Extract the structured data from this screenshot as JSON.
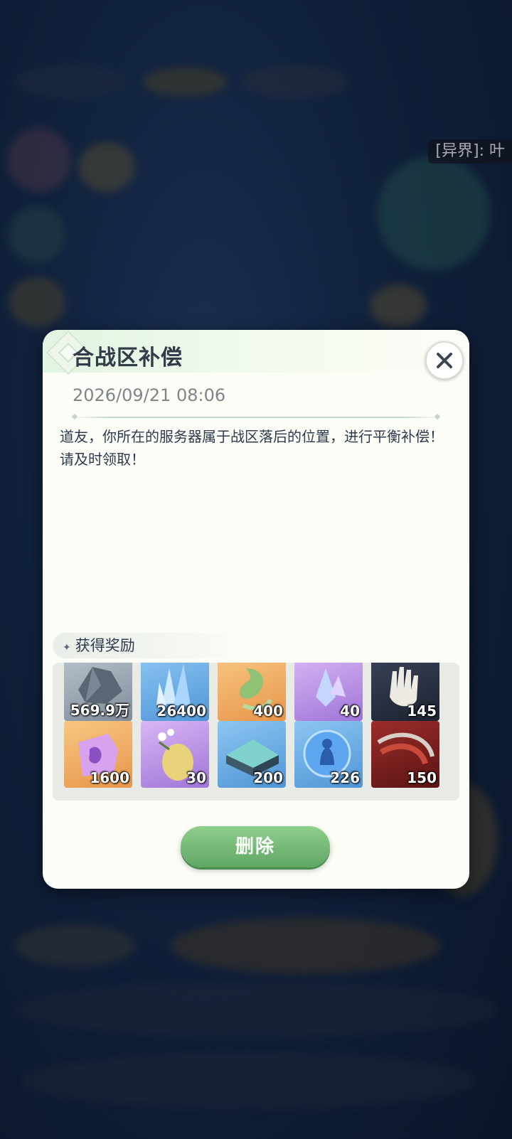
{
  "background": {
    "tag_text": "[异界]: 叶"
  },
  "dialog": {
    "title": "合战区补偿",
    "date": "2026/09/21 08:06",
    "message": "道友，你所在的服务器属于战区落后的位置，进行平衡补偿！请及时领取！",
    "rewards_label": "获得奖励",
    "rewards": [
      {
        "icon": "ore-icon",
        "count": "569.9万",
        "quality": "gray"
      },
      {
        "icon": "blue-crystal-icon",
        "count": "26400",
        "quality": "blue"
      },
      {
        "icon": "green-leaf-icon",
        "count": "400",
        "quality": "orange"
      },
      {
        "icon": "purple-crystal-icon",
        "count": "40",
        "quality": "purple"
      },
      {
        "icon": "hand-icon",
        "count": "145",
        "quality": "dark"
      },
      {
        "icon": "purple-stone-icon",
        "count": "1600",
        "quality": "orange"
      },
      {
        "icon": "fruit-icon",
        "count": "30",
        "quality": "purple"
      },
      {
        "icon": "chest-icon",
        "count": "200",
        "quality": "blue"
      },
      {
        "icon": "spirit-orb-icon",
        "count": "226",
        "quality": "blue"
      },
      {
        "icon": "red-swirl-icon",
        "count": "150",
        "quality": "red"
      }
    ],
    "delete_label": "删除"
  }
}
